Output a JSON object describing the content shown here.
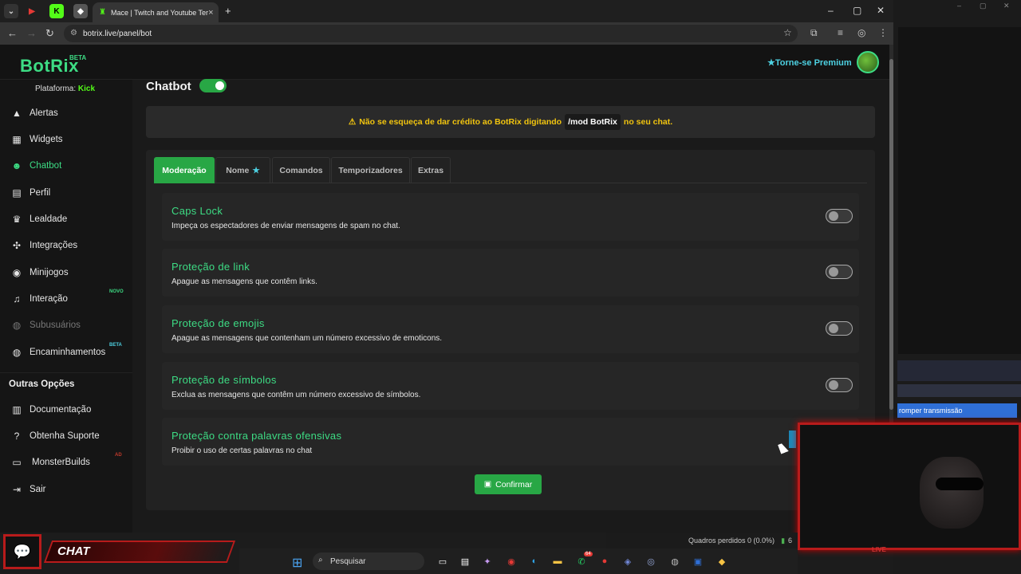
{
  "browser": {
    "tab_title": "Mace | Twitch and Youtube Ter",
    "url": "botrix.live/panel/bot",
    "win_min": "–",
    "win_max": "▢",
    "win_close": "✕",
    "new_tab": "+"
  },
  "app": {
    "logo": "BotRix",
    "logo_tag": "BETA",
    "premium_label": "Torne-se Premium",
    "platform_label": "Plataforma:",
    "platform_value": "Kick"
  },
  "sidebar": {
    "items": [
      {
        "label": "Alertas",
        "icon": "warning-icon",
        "glyph": "▲"
      },
      {
        "label": "Widgets",
        "icon": "grid-icon",
        "glyph": "▦"
      },
      {
        "label": "Chatbot",
        "icon": "robot-icon",
        "glyph": "☻"
      },
      {
        "label": "Perfil",
        "icon": "id-card-icon",
        "glyph": "▤"
      },
      {
        "label": "Lealdade",
        "icon": "trophy-icon",
        "glyph": "♛"
      },
      {
        "label": "Integrações",
        "icon": "puzzle-icon",
        "glyph": "✣"
      },
      {
        "label": "Minijogos",
        "icon": "gamepad-icon",
        "glyph": "◉"
      },
      {
        "label": "Interação",
        "icon": "music-icon",
        "glyph": "♫",
        "badge": "NOVO"
      },
      {
        "label": "Subusuários",
        "icon": "users-icon",
        "glyph": "◍"
      },
      {
        "label": "Encaminhamentos",
        "icon": "users-forward-icon",
        "glyph": "◍",
        "badge": "BETA"
      }
    ],
    "other_title": "Outras Opções",
    "other_items": [
      {
        "label": "Documentação",
        "icon": "book-icon",
        "glyph": "▥"
      },
      {
        "label": "Obtenha Suporte",
        "icon": "question-icon",
        "glyph": "?"
      },
      {
        "label": "MonsterBuilds",
        "icon": "monitor-icon",
        "glyph": "▭",
        "badge": "AD"
      },
      {
        "label": "Sair",
        "icon": "logout-icon",
        "glyph": "⇥"
      }
    ]
  },
  "main": {
    "title": "Chatbot",
    "notice_before": "Não se esqueça de dar crédito ao BotRix digitando",
    "notice_code": "/mod BotRix",
    "notice_after": "no seu chat.",
    "tabs": [
      "Moderação",
      "Nome",
      "Comandos",
      "Temporizadores",
      "Extras"
    ],
    "options": [
      {
        "title": "Caps Lock",
        "desc": "Impeça os espectadores de enviar mensagens de spam no chat."
      },
      {
        "title": "Proteção de link",
        "desc": "Apague as mensagens que contêm links."
      },
      {
        "title": "Proteção de emojis",
        "desc": "Apague as mensagens que contenham um número excessivo de emoticons."
      },
      {
        "title": "Proteção de símbolos",
        "desc": "Exclua as mensagens que contêm um número excessivo de símbolos."
      },
      {
        "title": "Proteção contra palavras ofensivas",
        "desc": "Proibir o uso de certas palavras no chat"
      }
    ],
    "confirm_label": "Confirmar"
  },
  "overlay": {
    "right_blue_text": "romper transmissão",
    "status_text": "Quadros perdidos 0 (0.0%)",
    "status_num": "6",
    "chat_label": "CHAT",
    "webcam_deco": "LIVE"
  },
  "taskbar": {
    "search_placeholder": "Pesquisar",
    "whatsapp_badge": "64"
  },
  "colors": {
    "accent": "#28a745",
    "brand_green": "#3ddc84",
    "premium": "#4dd0e1",
    "warning": "#f1c40f"
  }
}
